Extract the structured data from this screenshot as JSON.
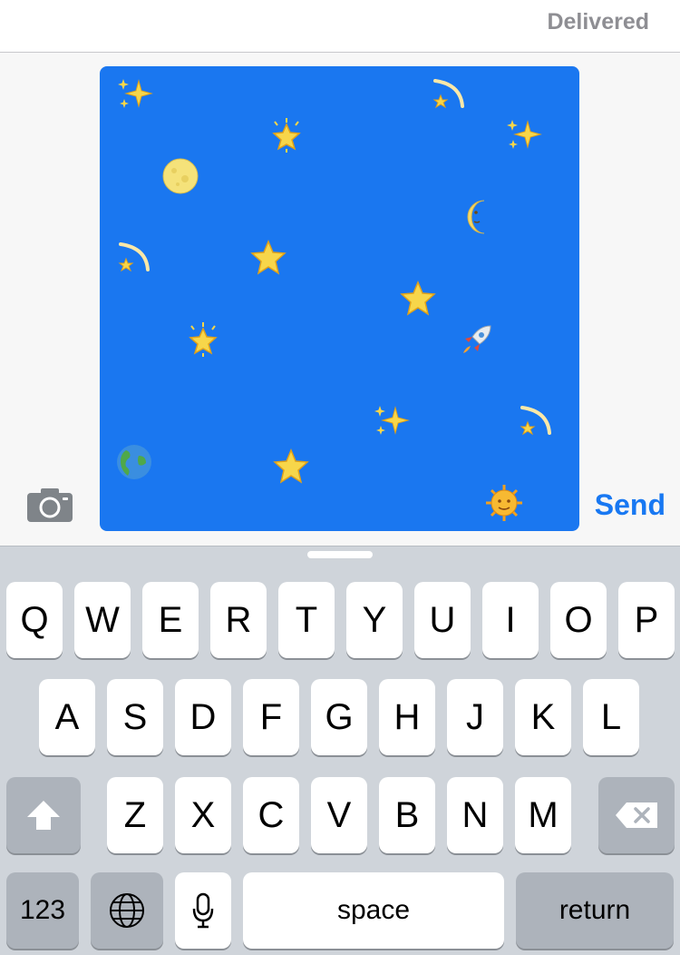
{
  "header": {
    "status": "Delivered"
  },
  "compose": {
    "send_label": "Send",
    "camera_icon": "camera-icon",
    "canvas": {
      "background": "#1a77f0",
      "stickers": [
        {
          "name": "sparkles-icon"
        },
        {
          "name": "shooting-star-icon"
        },
        {
          "name": "glowing-star-icon"
        },
        {
          "name": "sparkles-icon"
        },
        {
          "name": "full-moon-icon"
        },
        {
          "name": "crescent-moon-face-icon"
        },
        {
          "name": "shooting-star-icon"
        },
        {
          "name": "star-icon"
        },
        {
          "name": "star-icon"
        },
        {
          "name": "glowing-star-icon"
        },
        {
          "name": "rocket-icon"
        },
        {
          "name": "sparkles-icon"
        },
        {
          "name": "shooting-star-icon"
        },
        {
          "name": "globe-icon"
        },
        {
          "name": "star-icon"
        },
        {
          "name": "sun-face-icon"
        }
      ]
    }
  },
  "keyboard": {
    "row1": [
      "Q",
      "W",
      "E",
      "R",
      "T",
      "Y",
      "U",
      "I",
      "O",
      "P"
    ],
    "row2": [
      "A",
      "S",
      "D",
      "F",
      "G",
      "H",
      "J",
      "K",
      "L"
    ],
    "row3": [
      "Z",
      "X",
      "C",
      "V",
      "B",
      "N",
      "M"
    ],
    "numbers_label": "123",
    "space_label": "space",
    "return_label": "return",
    "globe_icon": "globe-icon",
    "mic_icon": "microphone-icon",
    "shift_icon": "shift-icon",
    "delete_icon": "delete-icon"
  },
  "colors": {
    "accent": "#1878f2",
    "canvas": "#1a77f0",
    "keyboard_bg": "#cfd4da",
    "key_dark": "#adb3bb"
  }
}
